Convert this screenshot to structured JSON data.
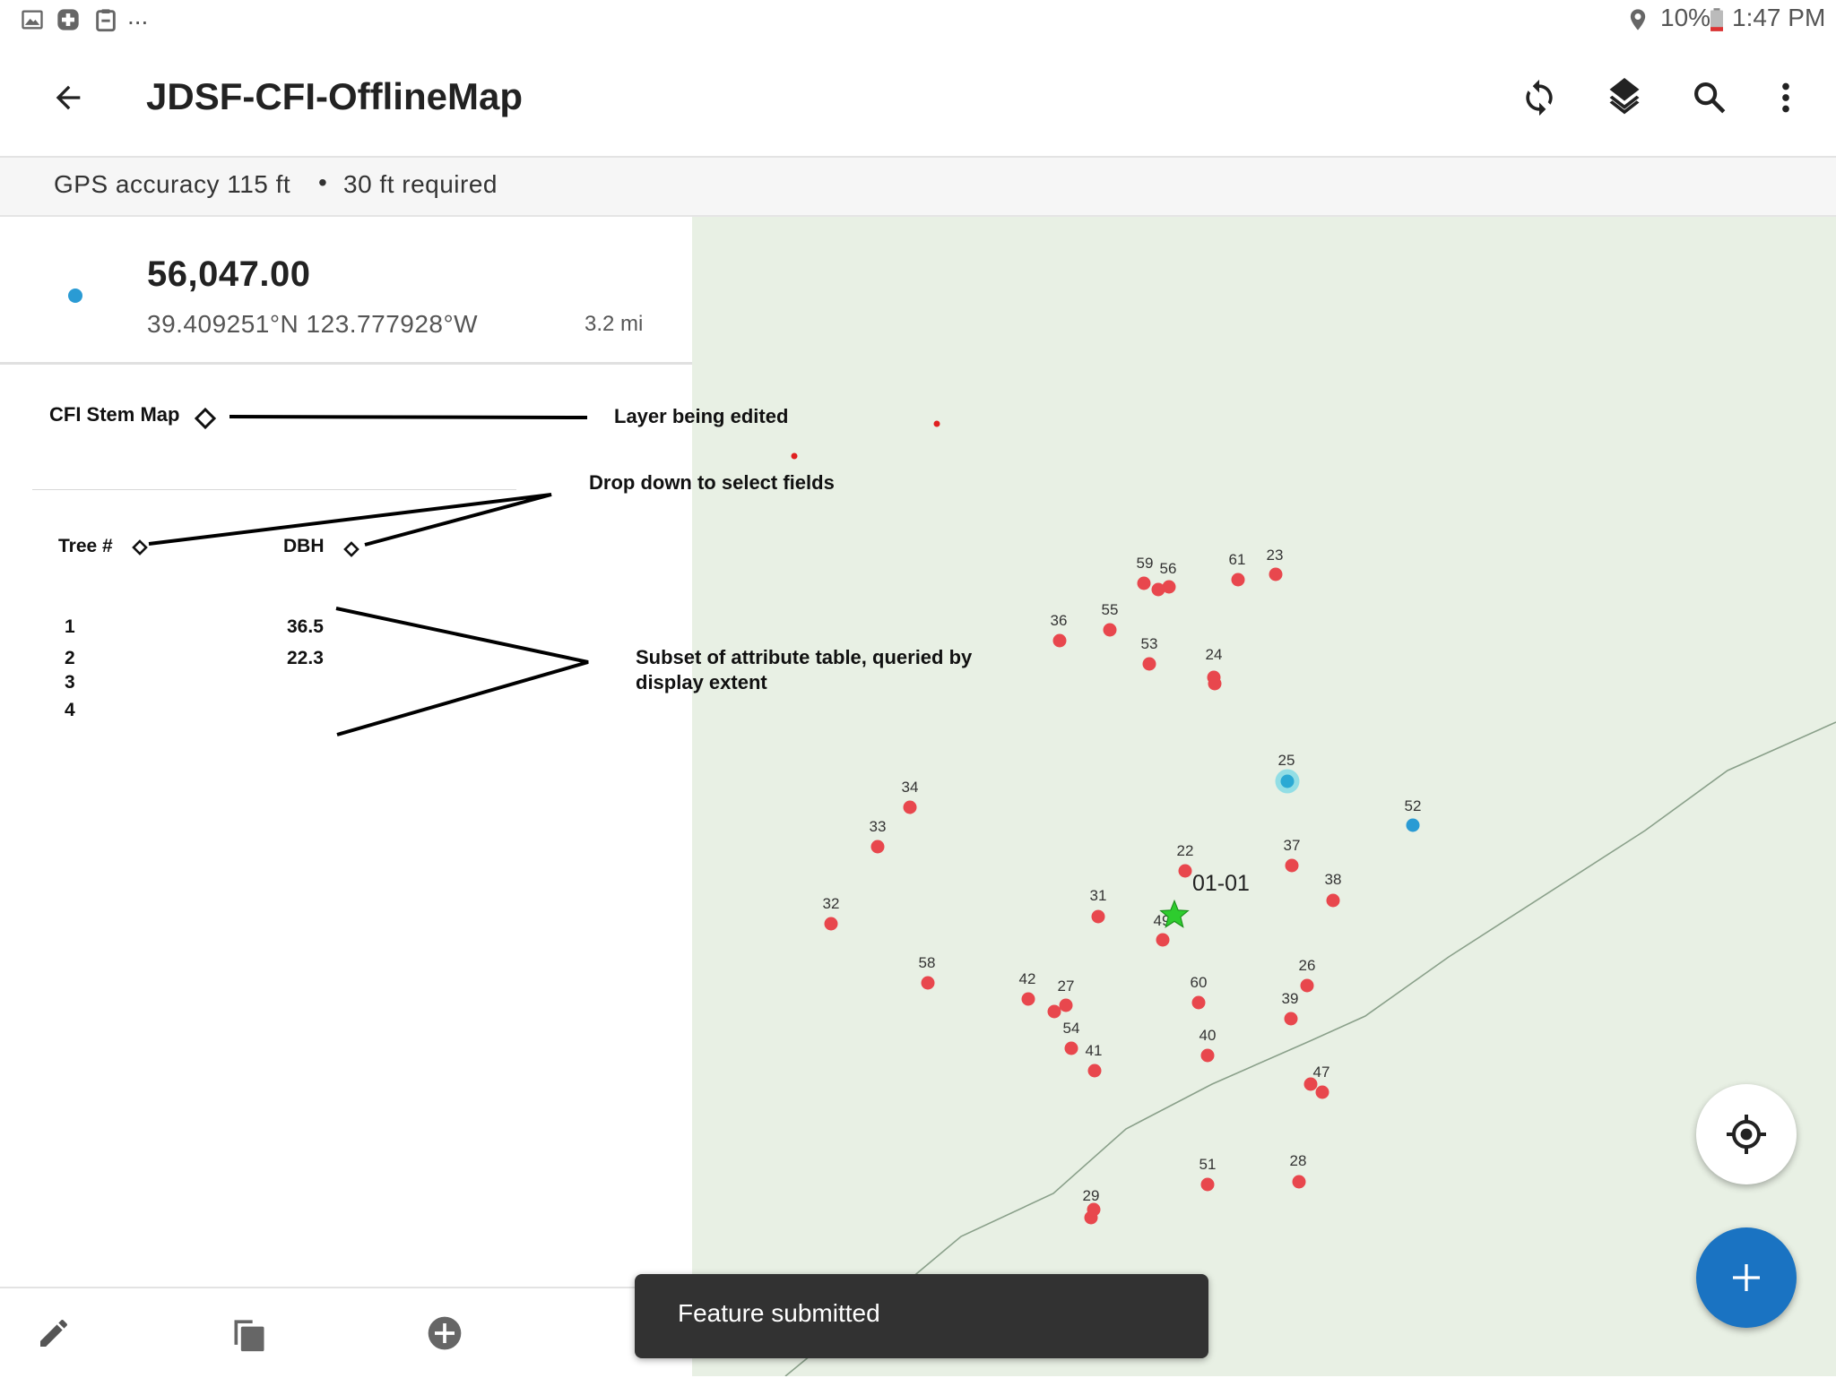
{
  "status_bar": {
    "more": "...",
    "battery": "10%",
    "time": "1:47 PM"
  },
  "app_bar": {
    "title": "JDSF-CFI-OfflineMap"
  },
  "gps": {
    "accuracy": "GPS accuracy 115 ft",
    "separator": "•",
    "required": "30 ft required"
  },
  "location": {
    "value": "56,047.00",
    "coords": "39.409251°N  123.777928°W",
    "distance": "3.2 mi"
  },
  "annotations": {
    "layer_name": "CFI Stem Map",
    "layer_note": "Layer being edited",
    "dropdown_note": "Drop down to select fields",
    "field_tree": "Tree #",
    "field_dbh": "DBH",
    "subset_note_line1": "Subset of attribute table, queried by",
    "subset_note_line2": "display extent"
  },
  "table": {
    "rows": [
      {
        "tree": "1",
        "dbh": "36.5"
      },
      {
        "tree": "2",
        "dbh": "22.3"
      },
      {
        "tree": "3",
        "dbh": ""
      },
      {
        "tree": "4",
        "dbh": ""
      }
    ]
  },
  "map": {
    "plot_label": "01-01",
    "point_labels": [
      "59",
      "56",
      "61",
      "23",
      "36",
      "55",
      "53",
      "24",
      "25",
      "52",
      "34",
      "33",
      "22",
      "37",
      "38",
      "32",
      "31",
      "49",
      "58",
      "42",
      "27",
      "60",
      "26",
      "39",
      "54",
      "41",
      "40",
      "47",
      "51",
      "28",
      "29"
    ]
  },
  "toast": {
    "text": "Feature submitted"
  },
  "colors": {
    "point": "#e8474d",
    "selected_point": "#2aa9d4",
    "fab": "#1a73c2",
    "map_bg": "#e8f0e4",
    "star": "#2ecc2e"
  }
}
